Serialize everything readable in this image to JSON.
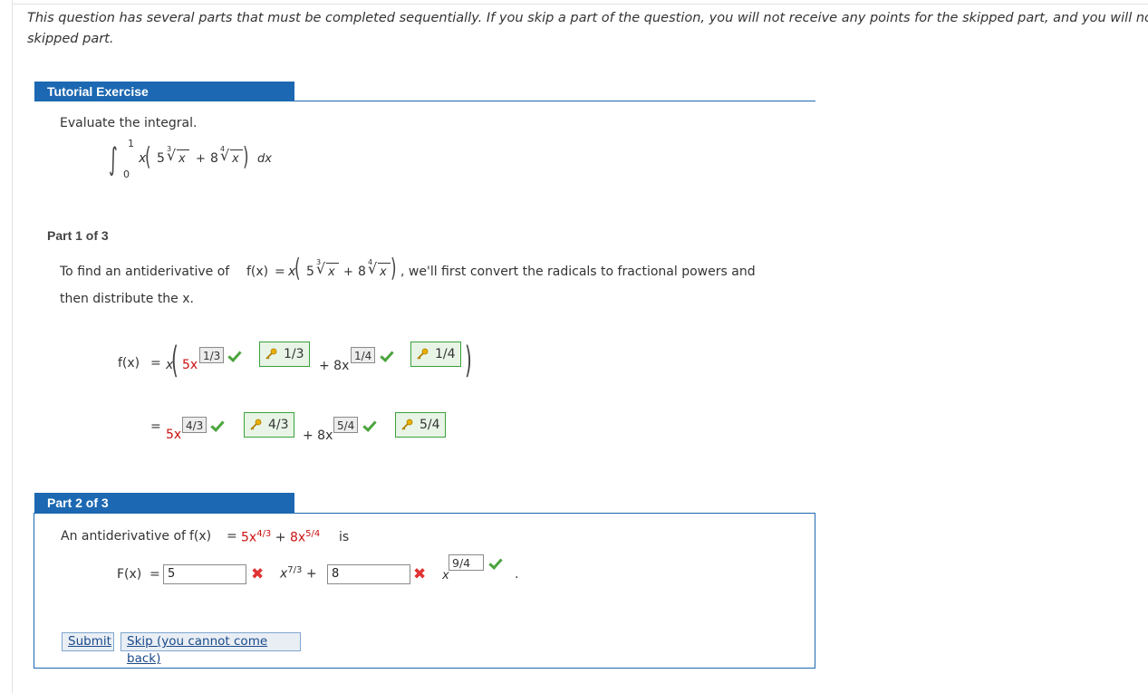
{
  "intro": {
    "line1": "This question has several parts that must be completed sequentially. If you skip a part of the question, you will not receive any points for the skipped part, and you will no",
    "line2": "skipped part."
  },
  "tutorial": {
    "tab_label": "Tutorial Exercise",
    "prompt": "Evaluate the integral.",
    "integral": {
      "upper": "1",
      "lower": "0",
      "body_x": "x",
      "c1": "5",
      "root1_index": "3",
      "radicand1": "x",
      "plus": "+",
      "c2": "8",
      "root2_index": "4",
      "radicand2": "x",
      "dx": "dx"
    }
  },
  "part1": {
    "label": "Part 1 of 3",
    "text_before": "To find an antiderivative of",
    "fx": "f(x)",
    "equals": "=",
    "text_after": ", we'll first convert the radicals to fractional powers and",
    "line2": "then distribute the x.",
    "row1": {
      "lhs": "f(x)",
      "eq": "=",
      "x": "x",
      "term1": "5x",
      "plus": "+ 8x",
      "ans1": "1/3",
      "key1": "1/3",
      "ans2": "1/4",
      "key2": "1/4"
    },
    "row2": {
      "eq": "=",
      "term1": "5x",
      "plus": "+ 8x",
      "ans1": "4/3",
      "key1": "4/3",
      "ans2": "5/4",
      "key2": "5/4"
    }
  },
  "part2": {
    "label": "Part 2 of 3",
    "text_before": "An antiderivative of",
    "fx": "f(x)",
    "eq": "=",
    "expr": {
      "a": "5x",
      "a_exp": "4/3",
      "plus": "+",
      "b": "8x",
      "b_exp": "5/4"
    },
    "is": "is",
    "Fx": "F(x)",
    "input1": "5",
    "mid_x": "x",
    "mid_exp": "7/3",
    "mid_plus": "+",
    "input2": "8",
    "end_x": "x",
    "end_ans": "9/4",
    "period": "."
  },
  "buttons": {
    "submit": "Submit",
    "skip": "Skip (you cannot come back)"
  },
  "colors": {
    "tab_blue": "#1c68b2",
    "red_text": "#cc1111",
    "check_green": "#4ca43e",
    "x_red": "#e03333",
    "key_green": "#3aa13a"
  },
  "icons": {
    "correct": "checkmark-icon",
    "incorrect": "x-mark-icon",
    "answer_key": "key-icon"
  }
}
